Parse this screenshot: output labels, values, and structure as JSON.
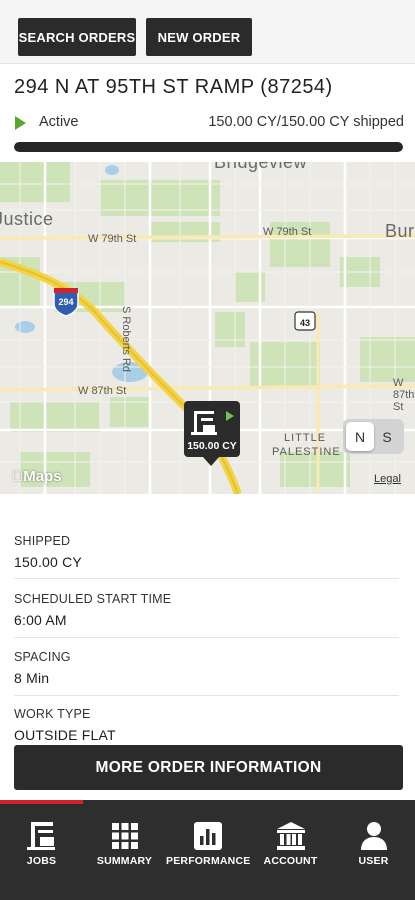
{
  "header": {
    "search_orders_label": "SEARCH ORDERS",
    "new_order_label": "NEW ORDER"
  },
  "order": {
    "title": "294 N AT 95TH ST RAMP (87254)",
    "status": "Active",
    "shipped_summary": "150.00 CY/150.00 CY shipped",
    "progress_fraction": 1.0,
    "status_color": "#5aa62f"
  },
  "map": {
    "place_labels": [
      "Bridgeview",
      "Justice",
      "Bur",
      "LITTLE",
      "PALESTINE"
    ],
    "street_labels": [
      "W 79th St",
      "W 79th St",
      "W 87th St",
      "W 87th St",
      "S Roberts Rd"
    ],
    "shields": [
      "294",
      "43"
    ],
    "brand": "Maps",
    "legal": "Legal",
    "marker_quantity": "150.00 CY",
    "toggle": {
      "n_label": "N",
      "s_label": "S",
      "selected": "N"
    }
  },
  "details": [
    {
      "label": "SHIPPED",
      "value": "150.00 CY"
    },
    {
      "label": "SCHEDULED START TIME",
      "value": "6:00 AM"
    },
    {
      "label": "SPACING",
      "value": "8 Min"
    },
    {
      "label": "WORK TYPE",
      "value": "OUTSIDE FLAT"
    }
  ],
  "more_info_label": "MORE ORDER INFORMATION",
  "bottom_nav": [
    {
      "label": "JOBS",
      "icon": "crane-icon",
      "active": true
    },
    {
      "label": "SUMMARY",
      "icon": "grid-icon",
      "active": false
    },
    {
      "label": "PERFORMANCE",
      "icon": "bar-chart-icon",
      "active": false
    },
    {
      "label": "ACCOUNT",
      "icon": "bank-icon",
      "active": false
    },
    {
      "label": "USER",
      "icon": "user-icon",
      "active": false
    }
  ],
  "colors": {
    "dark": "#2b2b2b",
    "accent_red": "#d2232a",
    "highway": "#f2d34a"
  }
}
